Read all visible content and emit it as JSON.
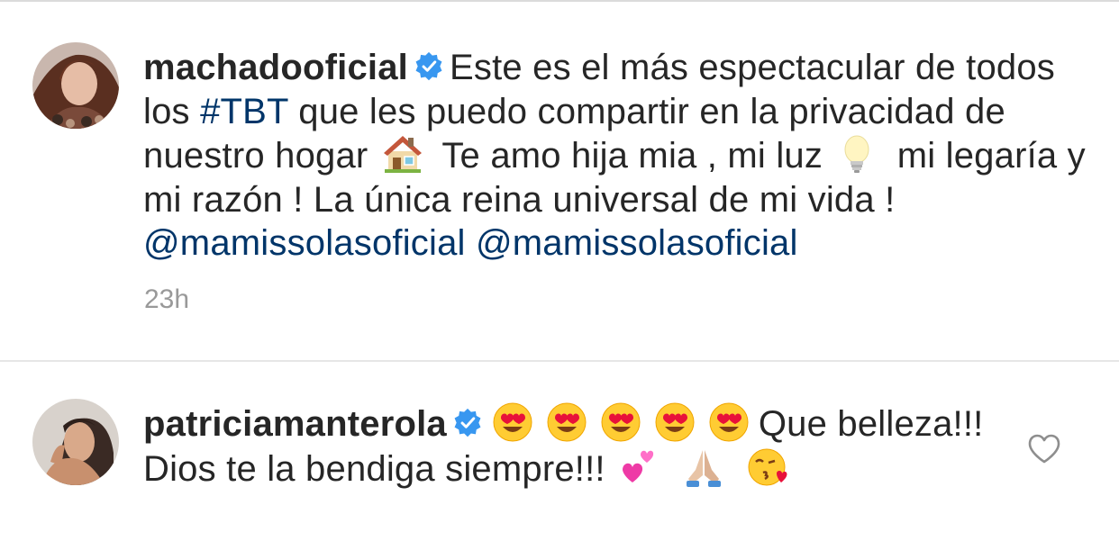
{
  "comments": [
    {
      "username": "machadooficial",
      "verified": true,
      "text_part1": "Este es el más espectacular de todos los",
      "hashtag": "#TBT",
      "text_part2": "que les puedo compartir en la privacidad de nuestro hogar",
      "emoji_house": "house-emoji",
      "text_part3": "Te amo hija mia , mi luz",
      "emoji_bulb": "light-bulb-emoji",
      "text_part4": "mi legaría y mi razón ! La única reina universal de mi vida !",
      "mention1": "@mamissolasoficial",
      "mention2": "@mamissolasoficial",
      "time": "23h"
    },
    {
      "username": "patriciamanterola",
      "verified": true,
      "emoji_heart_eyes": "heart-eyes-emoji",
      "text_part1": "Que belleza!!! Dios te la bendiga siempre!!!",
      "emoji_hearts": "two-hearts-emoji",
      "emoji_pray": "folded-hands-emoji",
      "emoji_kiss": "face-blowing-kiss-emoji"
    }
  ],
  "colors": {
    "username": "#262626",
    "link": "#003569",
    "timestamp": "#999999",
    "verified_badge": "#3897f0",
    "divider": "#e6e6e6"
  },
  "icons": {
    "like": "heart-outline-icon",
    "verified": "verified-badge-icon"
  }
}
